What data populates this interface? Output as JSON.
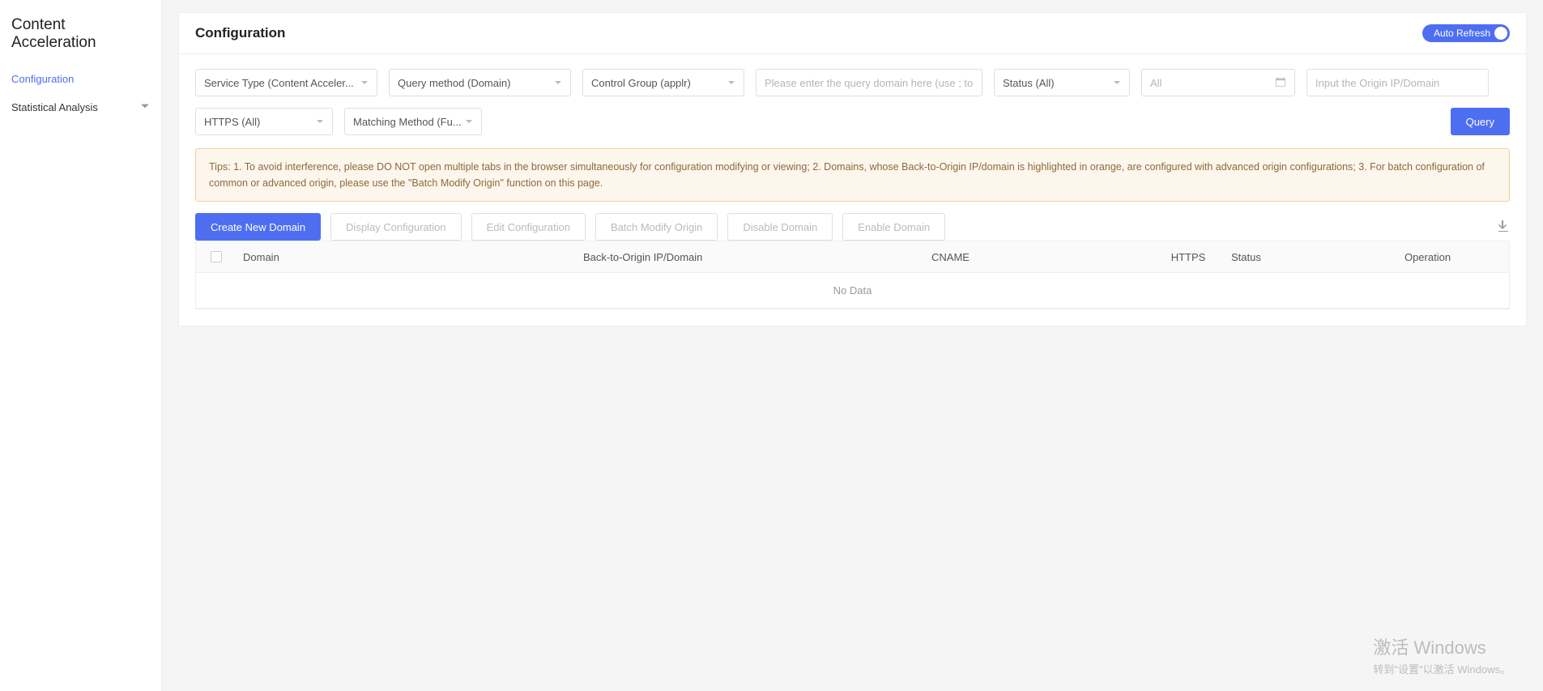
{
  "sidebar": {
    "title": "Content Acceleration",
    "items": [
      {
        "label": "Configuration",
        "active": true
      },
      {
        "label": "Statistical Analysis",
        "active": false,
        "expandable": true
      }
    ]
  },
  "header": {
    "title": "Configuration",
    "auto_refresh_label": "Auto Refresh"
  },
  "filters": {
    "service_type": "Service Type (Content Acceler...",
    "query_method": "Query method (Domain)",
    "control_group": "Control Group (applr)",
    "query_domain_placeholder": "Please enter the query domain here (use ; to s",
    "status": "Status (All)",
    "date_value": "All",
    "origin_ip_placeholder": "Input the Origin IP/Domain",
    "https": "HTTPS (All)",
    "matching_method": "Matching Method (Fu...",
    "query_btn": "Query"
  },
  "tips": "Tips: 1. To avoid interference, please DO NOT open multiple tabs in the browser simultaneously for configuration modifying or viewing; 2. Domains, whose Back-to-Origin IP/domain is highlighted in orange, are configured with advanced origin configurations; 3. For batch configuration of common or advanced origin, please use the \"Batch Modify Origin\" function on this page.",
  "actions": {
    "create": "Create New Domain",
    "display": "Display Configuration",
    "edit": "Edit Configuration",
    "batch": "Batch Modify Origin",
    "disable": "Disable Domain",
    "enable": "Enable Domain"
  },
  "table": {
    "columns": {
      "domain": "Domain",
      "origin": "Back-to-Origin IP/Domain",
      "cname": "CNAME",
      "https": "HTTPS",
      "status": "Status",
      "operation": "Operation"
    },
    "nodata": "No Data"
  },
  "watermark": {
    "line1": "激活 Windows",
    "line2": "转到\"设置\"以激活 Windows。"
  }
}
